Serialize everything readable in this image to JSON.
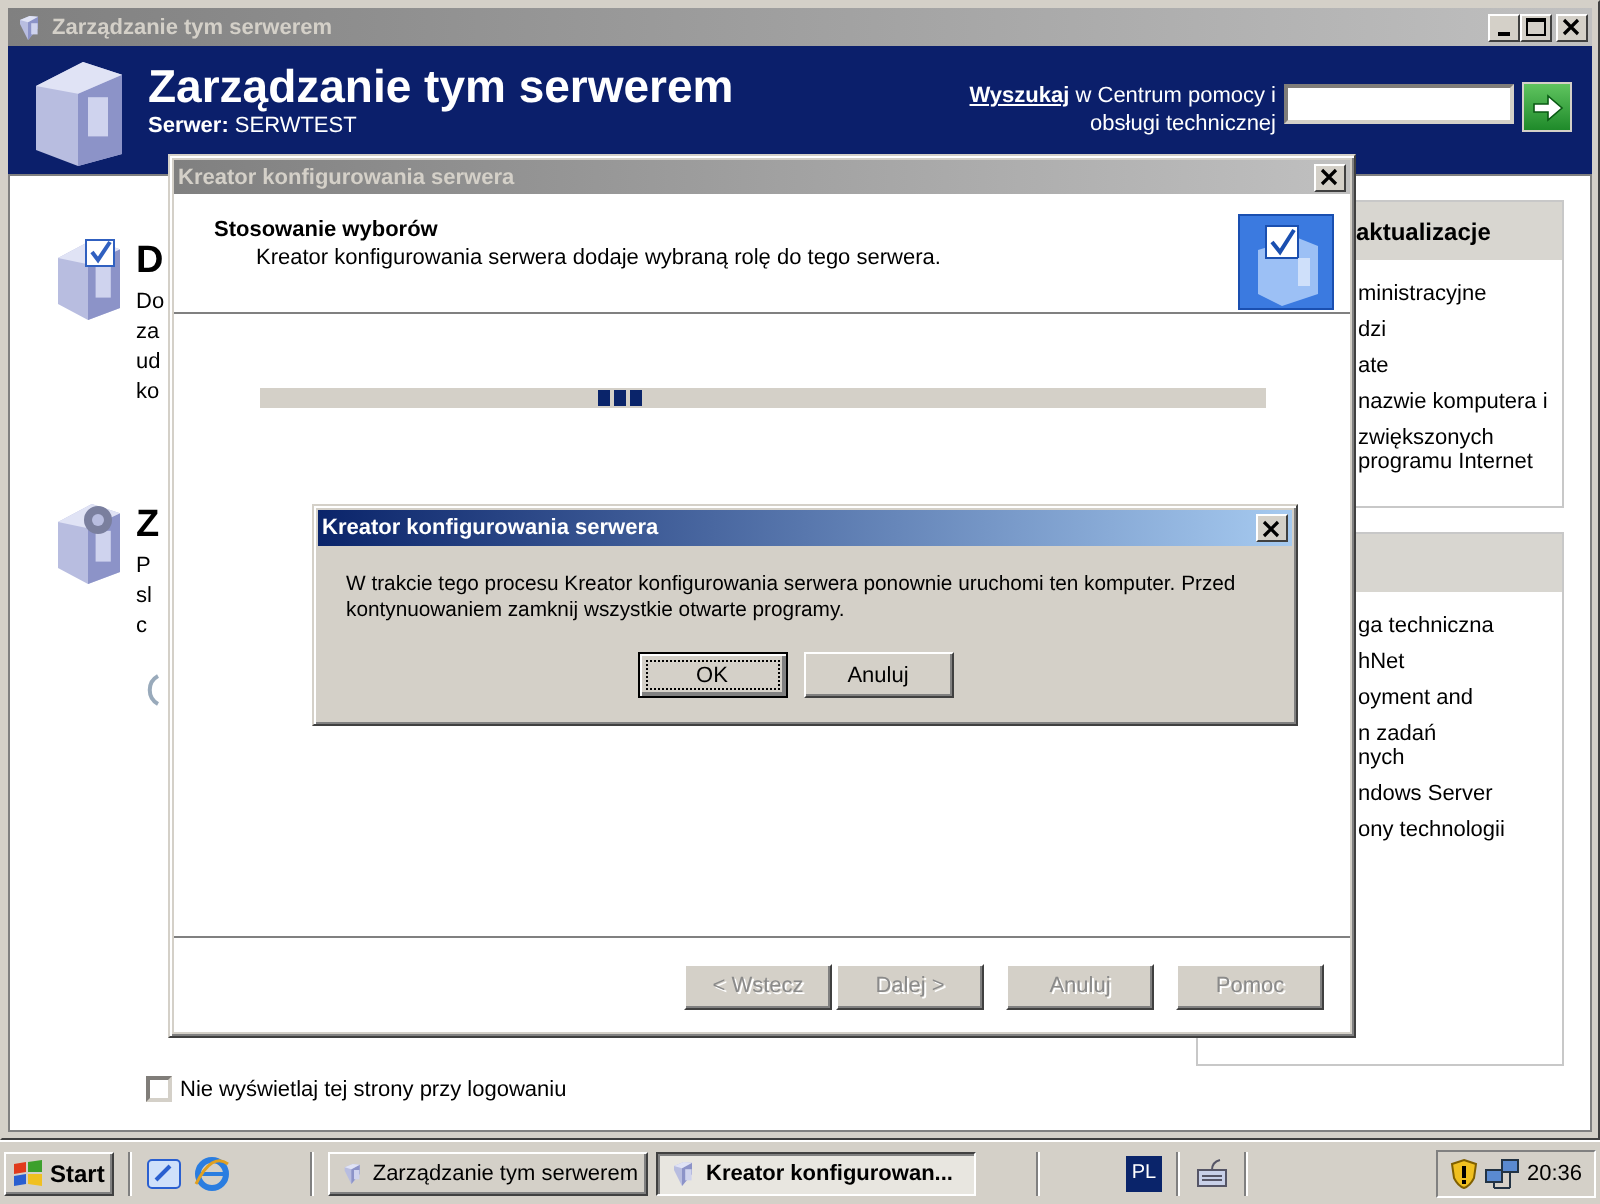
{
  "main_window": {
    "title": "Zarządzanie tym serwerem",
    "heading": "Zarządzanie tym serwerem",
    "server_label": "Serwer:",
    "server_name": "SERWTEST",
    "search": {
      "label": "Wyszukaj",
      "text_lines": [
        "w Centrum pomocy i",
        "obsługi technicznej"
      ]
    },
    "sections": [
      {
        "heading": "D",
        "lines": [
          "Do",
          "za",
          "ud",
          "ko"
        ]
      },
      {
        "heading": "Z",
        "lines": [
          "P",
          "sl",
          "c"
        ]
      }
    ],
    "side_panels": [
      {
        "heading": "aktualizacje",
        "items": [
          [
            "ministracyjne"
          ],
          [
            "dzi"
          ],
          [
            "ate"
          ],
          [
            "nazwie komputera i"
          ],
          [
            "zwiększonych",
            "programu Internet"
          ]
        ]
      },
      {
        "items": [
          [
            "ga techniczna"
          ],
          [
            "hNet"
          ],
          [
            "oyment and"
          ],
          [
            "n zadań",
            "nych"
          ],
          [
            "ndows Server"
          ],
          [
            "ony technologii"
          ]
        ]
      }
    ],
    "startup_option": {
      "label": "Nie wyświetlaj tej strony przy logowaniu",
      "checked": false
    }
  },
  "wizard": {
    "title": "Kreator konfigurowania serwera",
    "step_title": "Stosowanie wyborów",
    "step_description": "Kreator konfigurowania serwera dodaje wybraną rolę do tego serwera.",
    "buttons": [
      {
        "label": "< Wstecz",
        "disabled": true
      },
      {
        "label": "Dalej >",
        "disabled": true
      },
      {
        "label": "Anuluj",
        "disabled": true
      },
      {
        "label": "Pomoc",
        "disabled": true
      }
    ]
  },
  "message_box": {
    "title": "Kreator konfigurowania serwera",
    "message": "W trakcie tego procesu Kreator konfigurowania serwera ponownie uruchomi ten komputer. Przed kontynuowaniem zamknij wszystkie otwarte programy.",
    "buttons": [
      {
        "label": "OK",
        "selected": true
      },
      {
        "label": "Anuluj",
        "selected": false
      }
    ]
  },
  "taskbar": {
    "start": "Start",
    "tasks": [
      {
        "label": "Zarządzanie tym serwerem",
        "selected": false
      },
      {
        "label": "Kreator konfigurowan...",
        "selected": true
      }
    ],
    "language": "PL",
    "clock": "20:36"
  }
}
